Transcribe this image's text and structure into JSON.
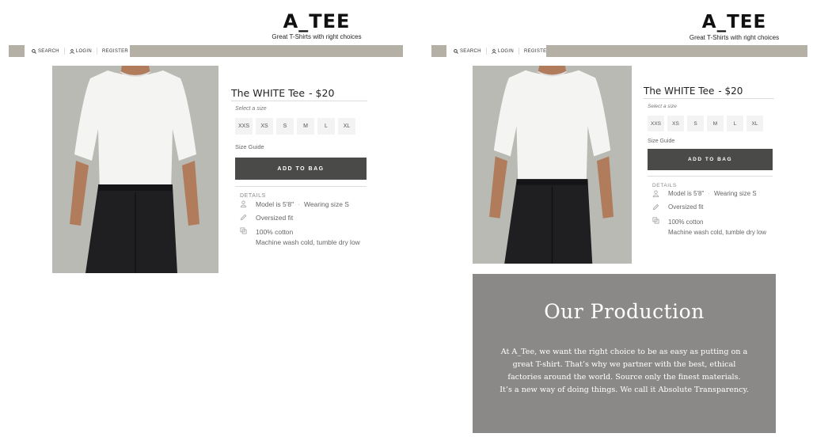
{
  "brand": {
    "logo": "A_TEE",
    "tagline": "Great T-Shirts with right choices"
  },
  "nav": {
    "search": "SEARCH",
    "login": "LOGIN",
    "register": "REGISTER",
    "bar_color": "#b5b0a5"
  },
  "product": {
    "name": "The WHITE Tee",
    "price": "- $20",
    "size_label": "Select a size",
    "sizes": [
      "XXS",
      "XS",
      "S",
      "M",
      "L",
      "XL"
    ],
    "size_guide": "Size Guide",
    "add_to_bag": "ADD TO BAG",
    "details_title": "DETAILS",
    "details": {
      "model": "Model is 5'8\"",
      "wearing": "Wearing size S",
      "fit": "Oversized fit",
      "material": "100% cotton",
      "care": "Machine wash cold, tumble dry low"
    },
    "button_color": "#4a4a48"
  },
  "production": {
    "title": "Our Production",
    "lines": [
      "At A_Tee, we want the right choice to be as  easy as putting on a",
      "great T-shirt.  That’s why we partner with the best, ethical",
      "factories around the world.  Source only the finest materials.",
      "It’s a new way of doing things.  We call it Absolute Transparency."
    ],
    "background": "#8a8987"
  }
}
